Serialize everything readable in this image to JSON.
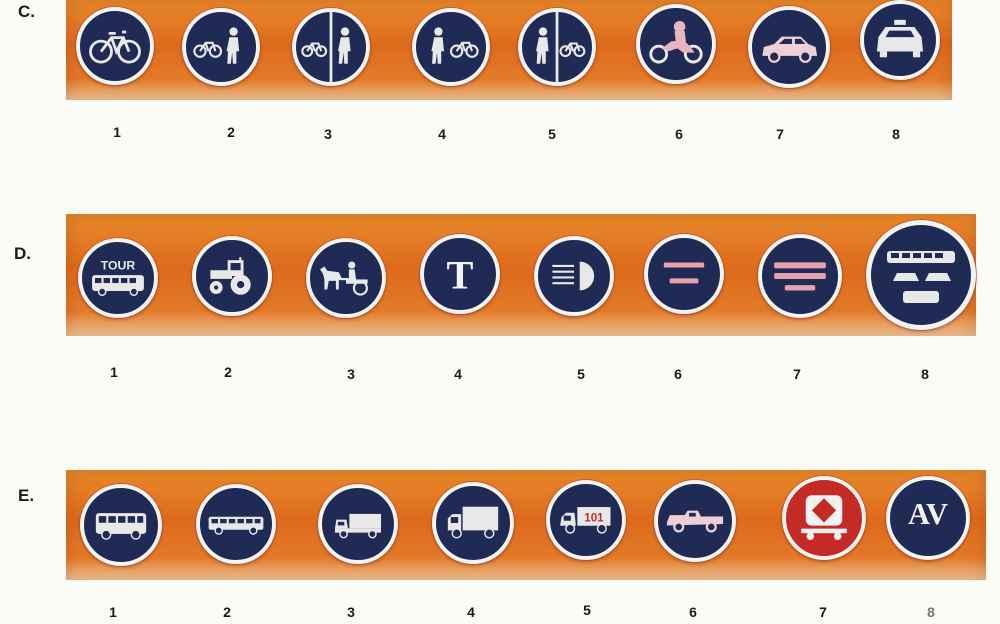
{
  "rows": [
    {
      "label": "C.",
      "signs": [
        {
          "number": "1",
          "icon": "bicycle-icon"
        },
        {
          "number": "2",
          "icon": "bicycle-and-pedestrian-icon"
        },
        {
          "number": "3",
          "icon": "bicycle-pedestrian-divided-icon"
        },
        {
          "number": "4",
          "icon": "pedestrian-and-bicycle-icon"
        },
        {
          "number": "5",
          "icon": "pedestrian-bicycle-divided-icon"
        },
        {
          "number": "6",
          "icon": "motorcycle-icon"
        },
        {
          "number": "7",
          "icon": "car-icon"
        },
        {
          "number": "8",
          "icon": "taxi-icon"
        }
      ]
    },
    {
      "label": "D.",
      "signs": [
        {
          "number": "1",
          "icon": "tour-bus-icon",
          "text": "TOUR"
        },
        {
          "number": "2",
          "icon": "tractor-icon"
        },
        {
          "number": "3",
          "icon": "horse-cart-icon"
        },
        {
          "number": "4",
          "icon": "tram-letter-icon",
          "text": "T"
        },
        {
          "number": "5",
          "icon": "headlight-icon"
        },
        {
          "number": "6",
          "icon": "lanes-icon"
        },
        {
          "number": "7",
          "icon": "vehicle-lanes-icon"
        },
        {
          "number": "8",
          "icon": "bus-lane-vehicles-icon"
        }
      ]
    },
    {
      "label": "E.",
      "signs": [
        {
          "number": "1",
          "icon": "bus-icon"
        },
        {
          "number": "2",
          "icon": "coach-icon"
        },
        {
          "number": "3",
          "icon": "small-truck-icon"
        },
        {
          "number": "4",
          "icon": "truck-icon"
        },
        {
          "number": "5",
          "icon": "numbered-truck-icon",
          "text": "101"
        },
        {
          "number": "6",
          "icon": "pickup-truck-icon"
        },
        {
          "number": "7",
          "icon": "hazard-vehicle-icon"
        },
        {
          "number": "8",
          "icon": "av-letters-icon",
          "text": "AV"
        }
      ]
    }
  ],
  "colors": {
    "strip": "#e0701f",
    "sign_background": "#1f2a55",
    "sign_border": "#f4f4f0",
    "hazard_sign_background": "#c42a26"
  }
}
